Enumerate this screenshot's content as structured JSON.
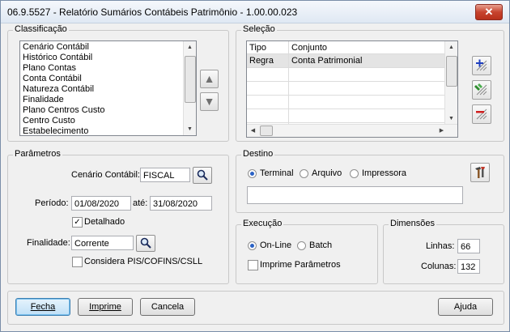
{
  "window": {
    "title": "06.9.5527 - Relatório Sumários Contábeis Patrimônio - 1.00.00.023",
    "close_label": "✕"
  },
  "classificacao": {
    "legend": "Classificação",
    "items": [
      "Cenário Contábil",
      "Histórico Contábil",
      "Plano Contas",
      "Conta Contábil",
      "Natureza Contábil",
      "Finalidade",
      "Plano Centros Custo",
      "Centro Custo",
      "Estabelecimento"
    ],
    "up_label": "▲",
    "down_label": "▼"
  },
  "selecao": {
    "legend": "Seleção",
    "columns": [
      "Tipo",
      "Conjunto"
    ],
    "rows": [
      [
        "Regra",
        "Conta Patrimonial"
      ],
      [
        "",
        ""
      ],
      [
        "",
        ""
      ],
      [
        "",
        ""
      ],
      [
        "",
        ""
      ],
      [
        "",
        ""
      ]
    ]
  },
  "parametros": {
    "legend": "Parâmetros",
    "cenario_label": "Cenário Contábil:",
    "cenario_value": "FISCAL",
    "periodo_label": "Período:",
    "periodo_inicio": "01/08/2020",
    "ate_label": "até:",
    "periodo_fim": "31/08/2020",
    "detalhado_label": "Detalhado",
    "detalhado_checked": true,
    "finalidade_label": "Finalidade:",
    "finalidade_value": "Corrente",
    "considera_label": "Considera PIS/COFINS/CSLL",
    "considera_checked": false
  },
  "destino": {
    "legend": "Destino",
    "options": [
      "Terminal",
      "Arquivo",
      "Impressora"
    ],
    "selected": "Terminal",
    "path_value": ""
  },
  "execucao": {
    "legend": "Execução",
    "options": [
      "On-Line",
      "Batch"
    ],
    "selected": "On-Line",
    "imprime_label": "Imprime Parâmetros",
    "imprime_checked": false
  },
  "dimensoes": {
    "legend": "Dimensões",
    "linhas_label": "Linhas:",
    "linhas_value": "66",
    "colunas_label": "Colunas:",
    "colunas_value": "132"
  },
  "buttons": {
    "fecha": "Fecha",
    "imprime": "Imprime",
    "cancela": "Cancela",
    "ajuda": "Ajuda"
  }
}
